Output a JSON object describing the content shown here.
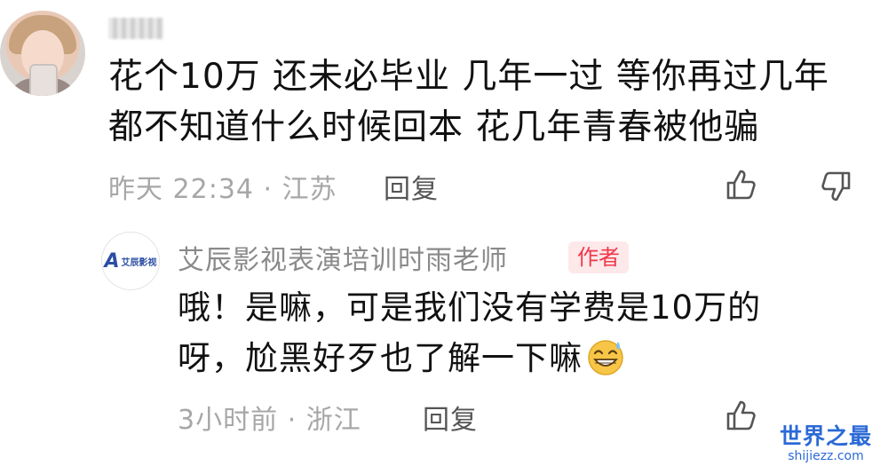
{
  "comments": [
    {
      "username": "",
      "text_line1": "花个10万 还未必毕业 几年一过 等你再过几年",
      "text_line2": "都不知道什么时候回本 花几年青春被他骗",
      "meta": "昨天 22:34 · 江苏",
      "reply_label": "回复",
      "like_icon": "thumbs-up-icon",
      "dislike_icon": "thumbs-down-icon"
    },
    {
      "avatar_logo_text": "艾辰影视",
      "username": "艾辰影视表演培训时雨老师",
      "badge": "作者",
      "text_line1": "哦！是嘛，可是我们没有学费是10万的",
      "text_line2": "呀，尬黑好歹也了解一下嘛",
      "emoji": "grinning-sweat-emoji",
      "meta": "3小时前 · 浙江",
      "reply_label": "回复",
      "like_icon": "thumbs-up-icon",
      "dislike_icon": "thumbs-down-icon"
    }
  ],
  "watermark": {
    "main": "世界之最",
    "sub": "shijiezz.com"
  },
  "colors": {
    "meta_gray": "#a7a7a7",
    "badge_bg": "#fde8ea",
    "badge_text": "#f0384b",
    "watermark_blue": "#2b6ad6"
  }
}
